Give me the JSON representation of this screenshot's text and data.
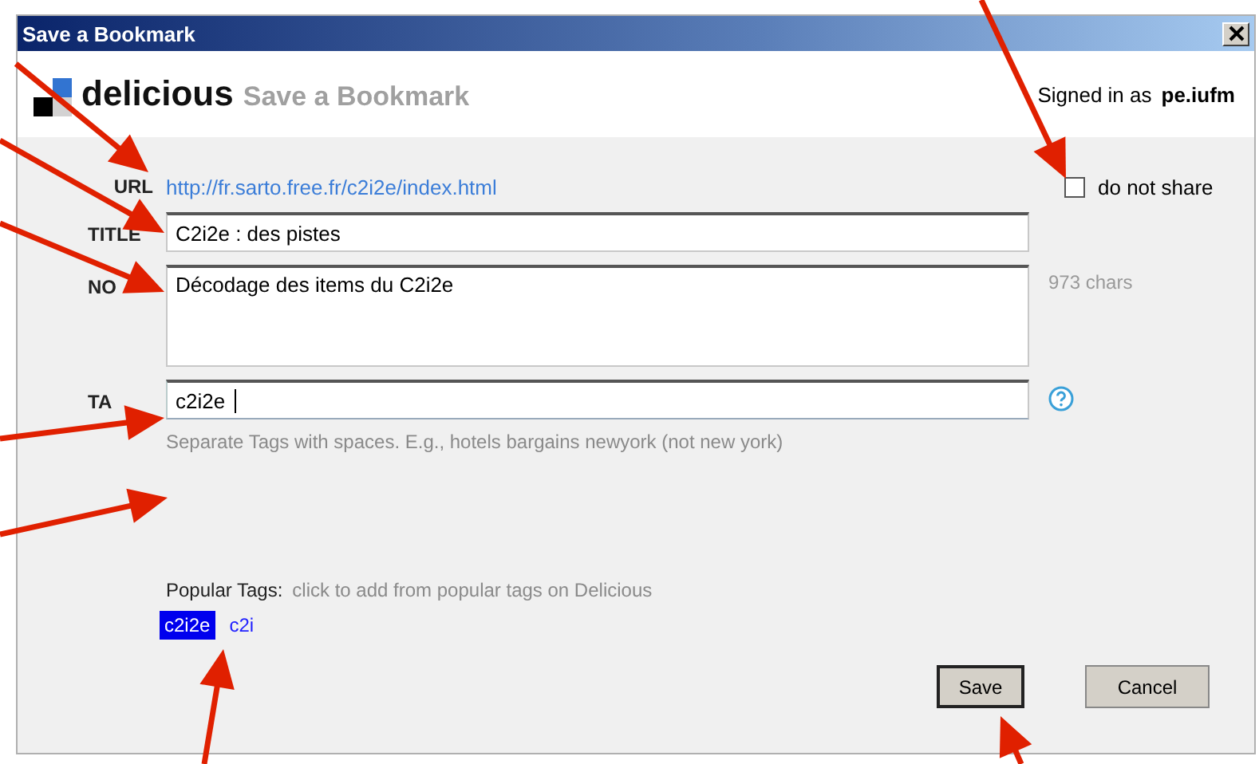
{
  "window": {
    "title": "Save a Bookmark"
  },
  "header": {
    "brand": "delicious",
    "subtitle": "Save a Bookmark",
    "signed_in_label": "Signed in as",
    "user": "pe.iufm"
  },
  "url": {
    "label": "URL",
    "value": "http://fr.sarto.free.fr/c2i2e/index.html"
  },
  "do_not_share": {
    "label": "do not share",
    "checked": false
  },
  "fields": [
    {
      "label": "TITLE",
      "kind": "line",
      "value": "C2i2e : des pistes",
      "focused": false
    },
    {
      "label": "NO",
      "kind": "area",
      "value": "Décodage des items du C2i2e",
      "counter": "973 chars",
      "focused": false
    },
    {
      "label": "TA",
      "kind": "line",
      "value": "c2i2e ",
      "focused": true,
      "help": true
    }
  ],
  "tags_hint": "Separate Tags with spaces. E.g., hotels bargains newyork (not new york)",
  "popular": {
    "label": "Popular Tags:",
    "hint": "click to add from popular tags on Delicious",
    "tags": [
      {
        "label": "c2i2e",
        "selected": true
      },
      {
        "label": "c2i",
        "selected": false
      }
    ]
  },
  "buttons": [
    {
      "label": "Save",
      "default": true
    },
    {
      "label": "Cancel",
      "default": false
    }
  ]
}
